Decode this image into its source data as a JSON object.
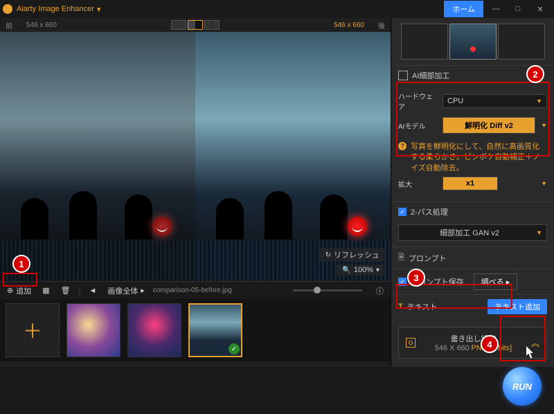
{
  "app": {
    "title": "Aiarty Image Enhancer",
    "home": "ホーム"
  },
  "viewer": {
    "before_label": "前",
    "after_label": "後",
    "dim_before": "546 x 660",
    "dim_after": "546 x 660",
    "refresh": "リフレッシュ",
    "zoom": "100%"
  },
  "toolbar": {
    "add": "追加",
    "scope": "画像全体",
    "filename": "comparison-05-before.jpg"
  },
  "ai": {
    "header": "AI細部加工",
    "hardware_label": "ハードウェア",
    "hardware_value": "CPU",
    "model_label": "AIモデル",
    "model_value": "鮮明化 Diff v2",
    "model_desc": "写真を鮮明化にして、自然に高画質化する柔らかさ。ピンボケ自動補正＋ノイズ自動除去。",
    "scale_label": "拡大",
    "scale_value": "x1",
    "twopass": "2-パス処理",
    "gan_value": "細部加工 GAN v2"
  },
  "prompt": {
    "header": "プロンプト",
    "save": "プロンプト保存",
    "adjust": "調べる"
  },
  "text": {
    "header": "テキスト",
    "add": "テキスト追加"
  },
  "export": {
    "header": "書き出し設定",
    "dims": "546 X 660",
    "format": "PNG",
    "bits": "[8 bits]"
  },
  "run": {
    "label": "RUN"
  },
  "callouts": {
    "c1": "1",
    "c2": "2",
    "c3": "3",
    "c4": "4"
  }
}
